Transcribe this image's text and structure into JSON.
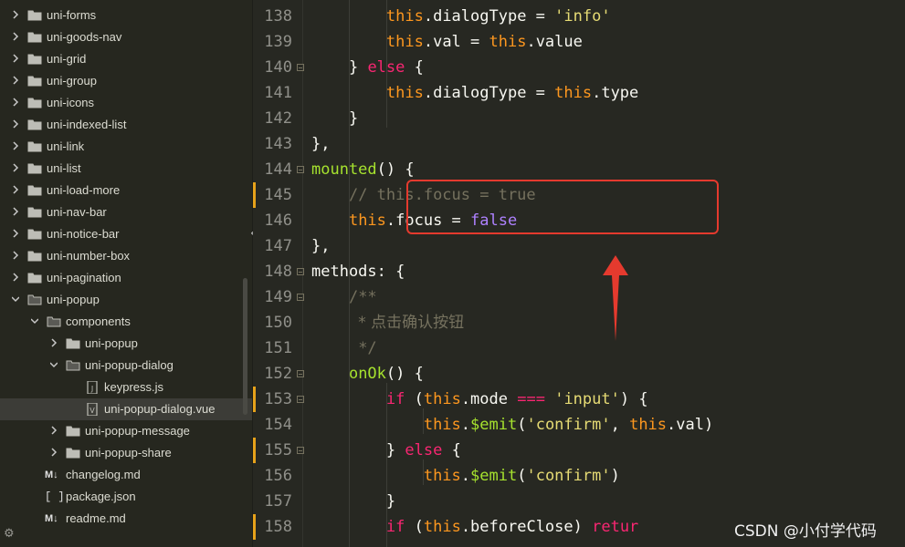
{
  "sidebar": {
    "items": [
      {
        "label": "uni-forms",
        "kind": "folder",
        "expanded": false
      },
      {
        "label": "uni-goods-nav",
        "kind": "folder",
        "expanded": false
      },
      {
        "label": "uni-grid",
        "kind": "folder",
        "expanded": false
      },
      {
        "label": "uni-group",
        "kind": "folder",
        "expanded": false
      },
      {
        "label": "uni-icons",
        "kind": "folder",
        "expanded": false
      },
      {
        "label": "uni-indexed-list",
        "kind": "folder",
        "expanded": false
      },
      {
        "label": "uni-link",
        "kind": "folder",
        "expanded": false
      },
      {
        "label": "uni-list",
        "kind": "folder",
        "expanded": false
      },
      {
        "label": "uni-load-more",
        "kind": "folder",
        "expanded": false
      },
      {
        "label": "uni-nav-bar",
        "kind": "folder",
        "expanded": false
      },
      {
        "label": "uni-notice-bar",
        "kind": "folder",
        "expanded": false
      },
      {
        "label": "uni-number-box",
        "kind": "folder",
        "expanded": false
      },
      {
        "label": "uni-pagination",
        "kind": "folder",
        "expanded": false
      },
      {
        "label": "uni-popup",
        "kind": "folder",
        "expanded": true
      },
      {
        "label": "components",
        "kind": "folder",
        "expanded": true
      },
      {
        "label": "uni-popup",
        "kind": "folder",
        "expanded": false
      },
      {
        "label": "uni-popup-dialog",
        "kind": "folder",
        "expanded": true
      },
      {
        "label": "keypress.js",
        "kind": "js-file"
      },
      {
        "label": "uni-popup-dialog.vue",
        "kind": "vue-file",
        "selected": true
      },
      {
        "label": "uni-popup-message",
        "kind": "folder",
        "expanded": false
      },
      {
        "label": "uni-popup-share",
        "kind": "folder",
        "expanded": false
      },
      {
        "label": "changelog.md",
        "kind": "md-file",
        "badge": "M↓"
      },
      {
        "label": "package.json",
        "kind": "json-file",
        "badge": "[ ]"
      },
      {
        "label": "readme.md",
        "kind": "md-file",
        "badge": "M↓"
      }
    ],
    "bottom_icon": "⚙"
  },
  "editor": {
    "lines": [
      {
        "num": "138",
        "fold": false,
        "modified": false,
        "tokens": [
          [
            "pad",
            "        "
          ],
          [
            "this",
            "this"
          ],
          [
            "prop",
            ".dialogType = "
          ],
          [
            "str",
            "'info'"
          ]
        ]
      },
      {
        "num": "139",
        "fold": false,
        "modified": false,
        "tokens": [
          [
            "pad",
            "        "
          ],
          [
            "this",
            "this"
          ],
          [
            "prop",
            ".val = "
          ],
          [
            "this",
            "this"
          ],
          [
            "prop",
            ".value"
          ]
        ]
      },
      {
        "num": "140",
        "fold": true,
        "modified": false,
        "tokens": [
          [
            "pad",
            "    "
          ],
          [
            "prop",
            "} "
          ],
          [
            "kw",
            "else"
          ],
          [
            "prop",
            " {"
          ]
        ]
      },
      {
        "num": "141",
        "fold": false,
        "modified": false,
        "tokens": [
          [
            "pad",
            "        "
          ],
          [
            "this",
            "this"
          ],
          [
            "prop",
            ".dialogType = "
          ],
          [
            "this",
            "this"
          ],
          [
            "prop",
            ".type"
          ]
        ]
      },
      {
        "num": "142",
        "fold": false,
        "modified": false,
        "tokens": [
          [
            "pad",
            "    "
          ],
          [
            "prop",
            "}"
          ]
        ]
      },
      {
        "num": "143",
        "fold": false,
        "modified": false,
        "tokens": [
          [
            "prop",
            "},"
          ]
        ]
      },
      {
        "num": "144",
        "fold": true,
        "modified": false,
        "tokens": [
          [
            "fn",
            "mounted"
          ],
          [
            "prop",
            "() {"
          ]
        ]
      },
      {
        "num": "145",
        "fold": false,
        "modified": true,
        "tokens": [
          [
            "pad",
            "    "
          ],
          [
            "cm",
            "// this.focus = true"
          ]
        ]
      },
      {
        "num": "146",
        "fold": false,
        "modified": false,
        "tokens": [
          [
            "pad",
            "    "
          ],
          [
            "this",
            "this"
          ],
          [
            "prop",
            ".focus = "
          ],
          [
            "bool",
            "false"
          ]
        ]
      },
      {
        "num": "147",
        "fold": false,
        "modified": false,
        "tokens": [
          [
            "prop",
            "},"
          ]
        ]
      },
      {
        "num": "148",
        "fold": true,
        "modified": false,
        "tokens": [
          [
            "prop",
            "methods: {"
          ]
        ]
      },
      {
        "num": "149",
        "fold": true,
        "modified": false,
        "tokens": [
          [
            "pad",
            "    "
          ],
          [
            "cm",
            "/**"
          ]
        ]
      },
      {
        "num": "150",
        "fold": false,
        "modified": false,
        "tokens": [
          [
            "pad",
            "     "
          ],
          [
            "cm-cn",
            "* 点击确认按钮"
          ]
        ]
      },
      {
        "num": "151",
        "fold": false,
        "modified": false,
        "tokens": [
          [
            "pad",
            "     "
          ],
          [
            "cm",
            "*/"
          ]
        ]
      },
      {
        "num": "152",
        "fold": true,
        "modified": false,
        "tokens": [
          [
            "pad",
            "    "
          ],
          [
            "fn",
            "onOk"
          ],
          [
            "prop",
            "() {"
          ]
        ]
      },
      {
        "num": "153",
        "fold": true,
        "modified": true,
        "tokens": [
          [
            "pad",
            "        "
          ],
          [
            "kw",
            "if"
          ],
          [
            "prop",
            " ("
          ],
          [
            "this",
            "this"
          ],
          [
            "prop",
            ".mode "
          ],
          [
            "kw",
            "==="
          ],
          [
            "prop",
            " "
          ],
          [
            "str",
            "'input'"
          ],
          [
            "prop",
            ") {"
          ]
        ]
      },
      {
        "num": "154",
        "fold": false,
        "modified": false,
        "tokens": [
          [
            "pad",
            "            "
          ],
          [
            "this",
            "this"
          ],
          [
            "prop",
            "."
          ],
          [
            "fn",
            "$emit"
          ],
          [
            "prop",
            "("
          ],
          [
            "str",
            "'confirm'"
          ],
          [
            "prop",
            ", "
          ],
          [
            "this",
            "this"
          ],
          [
            "prop",
            ".val)"
          ]
        ]
      },
      {
        "num": "155",
        "fold": true,
        "modified": true,
        "tokens": [
          [
            "pad",
            "        "
          ],
          [
            "prop",
            "} "
          ],
          [
            "kw",
            "else"
          ],
          [
            "prop",
            " {"
          ]
        ]
      },
      {
        "num": "156",
        "fold": false,
        "modified": false,
        "tokens": [
          [
            "pad",
            "            "
          ],
          [
            "this",
            "this"
          ],
          [
            "prop",
            "."
          ],
          [
            "fn",
            "$emit"
          ],
          [
            "prop",
            "("
          ],
          [
            "str",
            "'confirm'"
          ],
          [
            "prop",
            ")"
          ]
        ]
      },
      {
        "num": "157",
        "fold": false,
        "modified": false,
        "tokens": [
          [
            "pad",
            "        "
          ],
          [
            "prop",
            "}"
          ]
        ]
      },
      {
        "num": "158",
        "fold": false,
        "modified": true,
        "tokens": [
          [
            "pad",
            "        "
          ],
          [
            "kw",
            "if"
          ],
          [
            "prop",
            " ("
          ],
          [
            "this",
            "this"
          ],
          [
            "prop",
            ".beforeClose) "
          ],
          [
            "kw",
            "retur"
          ]
        ]
      }
    ]
  },
  "annotation": {
    "box_color": "#e53a2e",
    "arrow_color": "#e53a2e"
  },
  "watermark": "CSDN @小付学代码"
}
